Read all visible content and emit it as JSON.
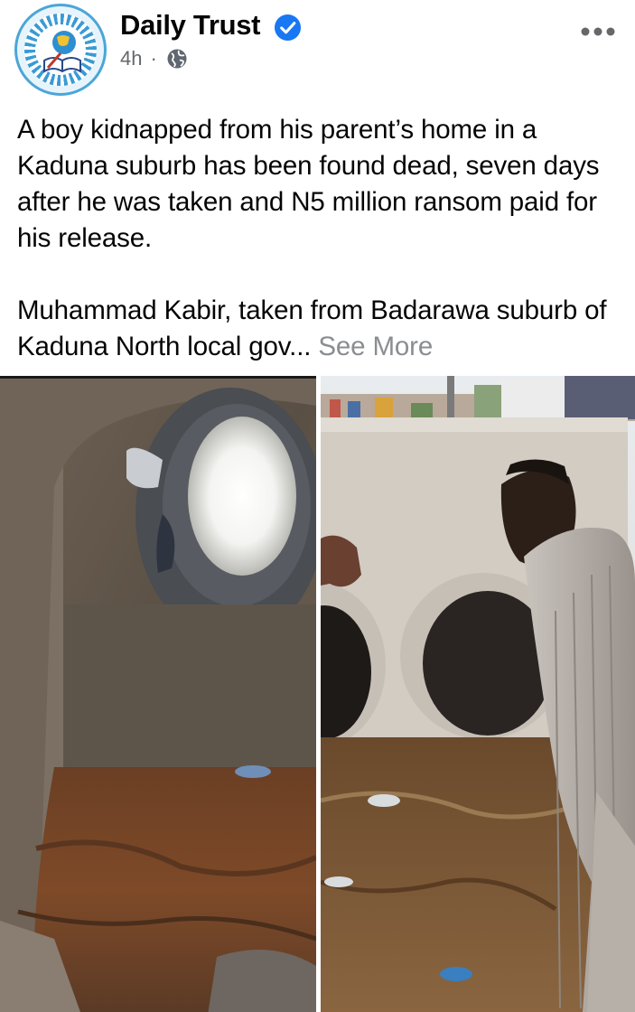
{
  "page": {
    "name": "Daily Trust",
    "verified_icon": "verified-badge-icon",
    "time": "4h",
    "separator": "·",
    "audience_icon": "globe-icon",
    "more_icon": "more-options-icon"
  },
  "post": {
    "paragraphs": [
      "A boy kidnapped from his parent’s home in a Kaduna suburb has been found dead, seven days after he was taken and N5 million ransom paid for his release.",
      "Muhammad Kabir, taken from Badarawa suburb of Kaduna North local gov..."
    ],
    "see_more_label": "See More"
  },
  "colors": {
    "text": "#050505",
    "secondary": "#65676b",
    "see_more": "#8a8d91",
    "verified": "#1877f2"
  }
}
